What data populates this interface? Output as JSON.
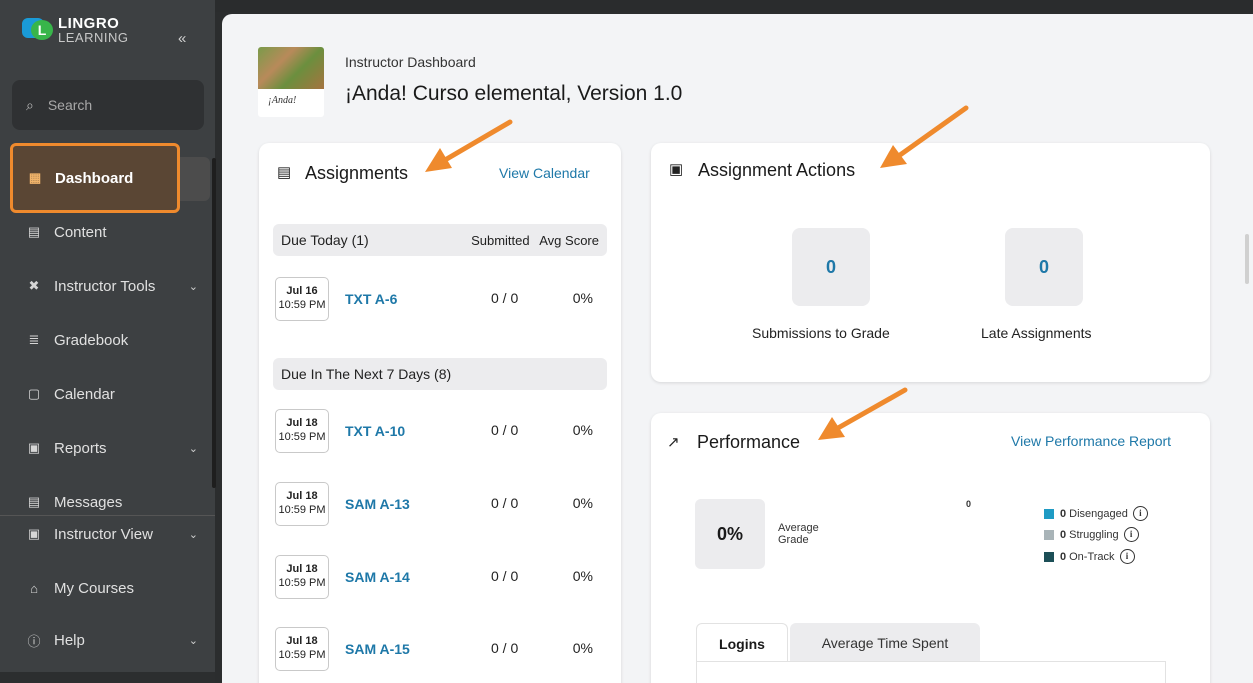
{
  "sidebar": {
    "logo_line1": "LINGRO",
    "logo_line2": "LEARNING",
    "logo_badge": "L",
    "collapse_glyph": "«",
    "search_placeholder": "Search",
    "items": [
      {
        "label": "Dashboard",
        "icon": "dashboard-icon",
        "active": true
      },
      {
        "label": "Content",
        "icon": "book-icon"
      },
      {
        "label": "Instructor Tools",
        "icon": "tools-icon",
        "has_chevron": true
      },
      {
        "label": "Gradebook",
        "icon": "gradebook-icon"
      },
      {
        "label": "Calendar",
        "icon": "calendar-icon"
      },
      {
        "label": "Reports",
        "icon": "reports-icon",
        "has_chevron": true
      },
      {
        "label": "Messages",
        "icon": "messages-icon"
      },
      {
        "label": "Instructor View",
        "icon": "instructor-view-icon",
        "has_chevron": true
      },
      {
        "label": "My Courses",
        "icon": "home-icon"
      },
      {
        "label": "Help",
        "icon": "help-icon",
        "has_chevron": true
      }
    ]
  },
  "header": {
    "breadcrumb": "Instructor Dashboard",
    "course_title": "¡Anda! Curso elemental, Version 1.0",
    "thumb_caption": "¡Anda!"
  },
  "assignments": {
    "title": "Assignments",
    "view_calendar": "View Calendar",
    "due_today": {
      "label": "Due Today",
      "count": "(1)",
      "col_submitted": "Submitted",
      "col_avg": "Avg Score"
    },
    "due_next": {
      "label": "Due In The Next 7 Days",
      "count": "(8)"
    },
    "rows": [
      {
        "date": "Jul 16",
        "time": "10:59 PM",
        "name": "TXT A-6",
        "submitted": "0 / 0",
        "avg": "0%"
      },
      {
        "date": "Jul 18",
        "time": "10:59 PM",
        "name": "TXT A-10",
        "submitted": "0 / 0",
        "avg": "0%"
      },
      {
        "date": "Jul 18",
        "time": "10:59 PM",
        "name": "SAM A-13",
        "submitted": "0 / 0",
        "avg": "0%"
      },
      {
        "date": "Jul 18",
        "time": "10:59 PM",
        "name": "SAM A-14",
        "submitted": "0 / 0",
        "avg": "0%"
      },
      {
        "date": "Jul 18",
        "time": "10:59 PM",
        "name": "SAM A-15",
        "submitted": "0 / 0",
        "avg": "0%"
      }
    ]
  },
  "actions": {
    "title": "Assignment Actions",
    "submissions_value": "0",
    "submissions_label": "Submissions to Grade",
    "late_value": "0",
    "late_label": "Late Assignments"
  },
  "performance": {
    "title": "Performance",
    "report_link": "View Performance Report",
    "avg_value": "0%",
    "avg_label_1": "Average",
    "avg_label_2": "Grade",
    "zero_mark": "0",
    "info_glyph": "i",
    "legend": [
      {
        "count": "0",
        "label": "Disengaged",
        "color": "#1f9bc4"
      },
      {
        "count": "0",
        "label": "Struggling",
        "color": "#a9b4b8"
      },
      {
        "count": "0",
        "label": "On-Track",
        "color": "#1c4f57"
      }
    ],
    "tabs": [
      "Logins",
      "Average Time Spent"
    ]
  },
  "colors": {
    "accent_orange": "#ef8a2d",
    "link_blue": "#1e78a8",
    "sidebar_bg": "#3d4042"
  }
}
